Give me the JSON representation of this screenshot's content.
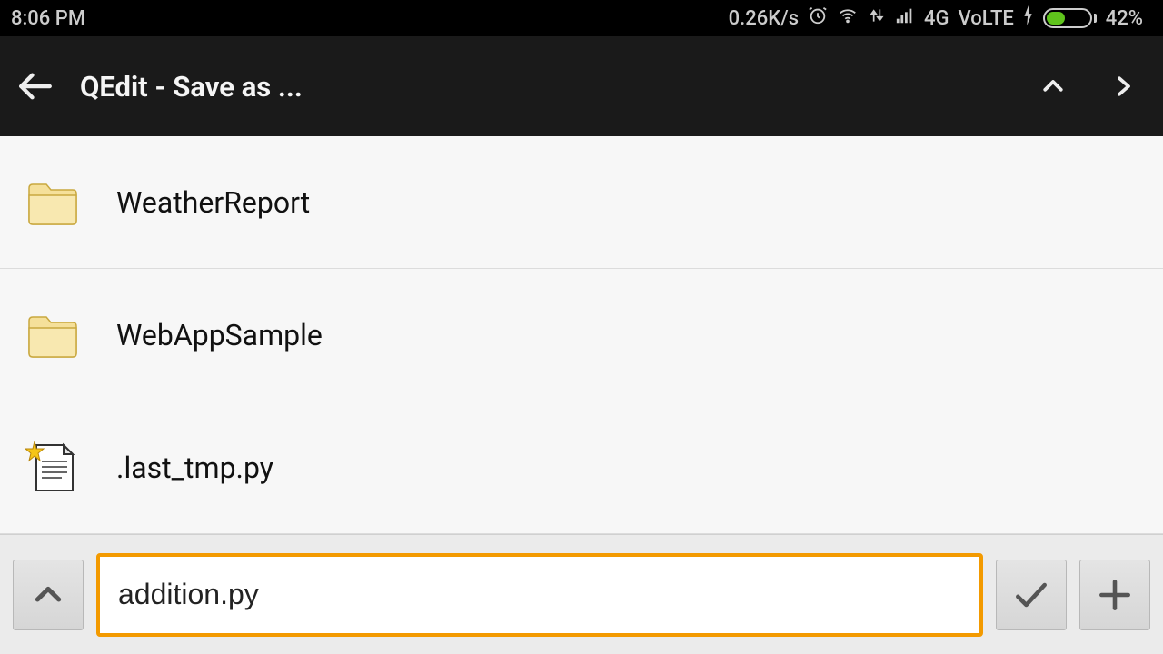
{
  "statusbar": {
    "time": "8:06 PM",
    "net_speed": "0.26K/s",
    "network_label": "4G",
    "volte_label": "VoLTE",
    "battery_pct": "42%"
  },
  "appbar": {
    "title": "QEdit - Save as ..."
  },
  "files": [
    {
      "name": "WeatherReport",
      "type": "folder"
    },
    {
      "name": "WebAppSample",
      "type": "folder"
    },
    {
      "name": ".last_tmp.py",
      "type": "file"
    }
  ],
  "bottombar": {
    "filename": "addition.py"
  }
}
